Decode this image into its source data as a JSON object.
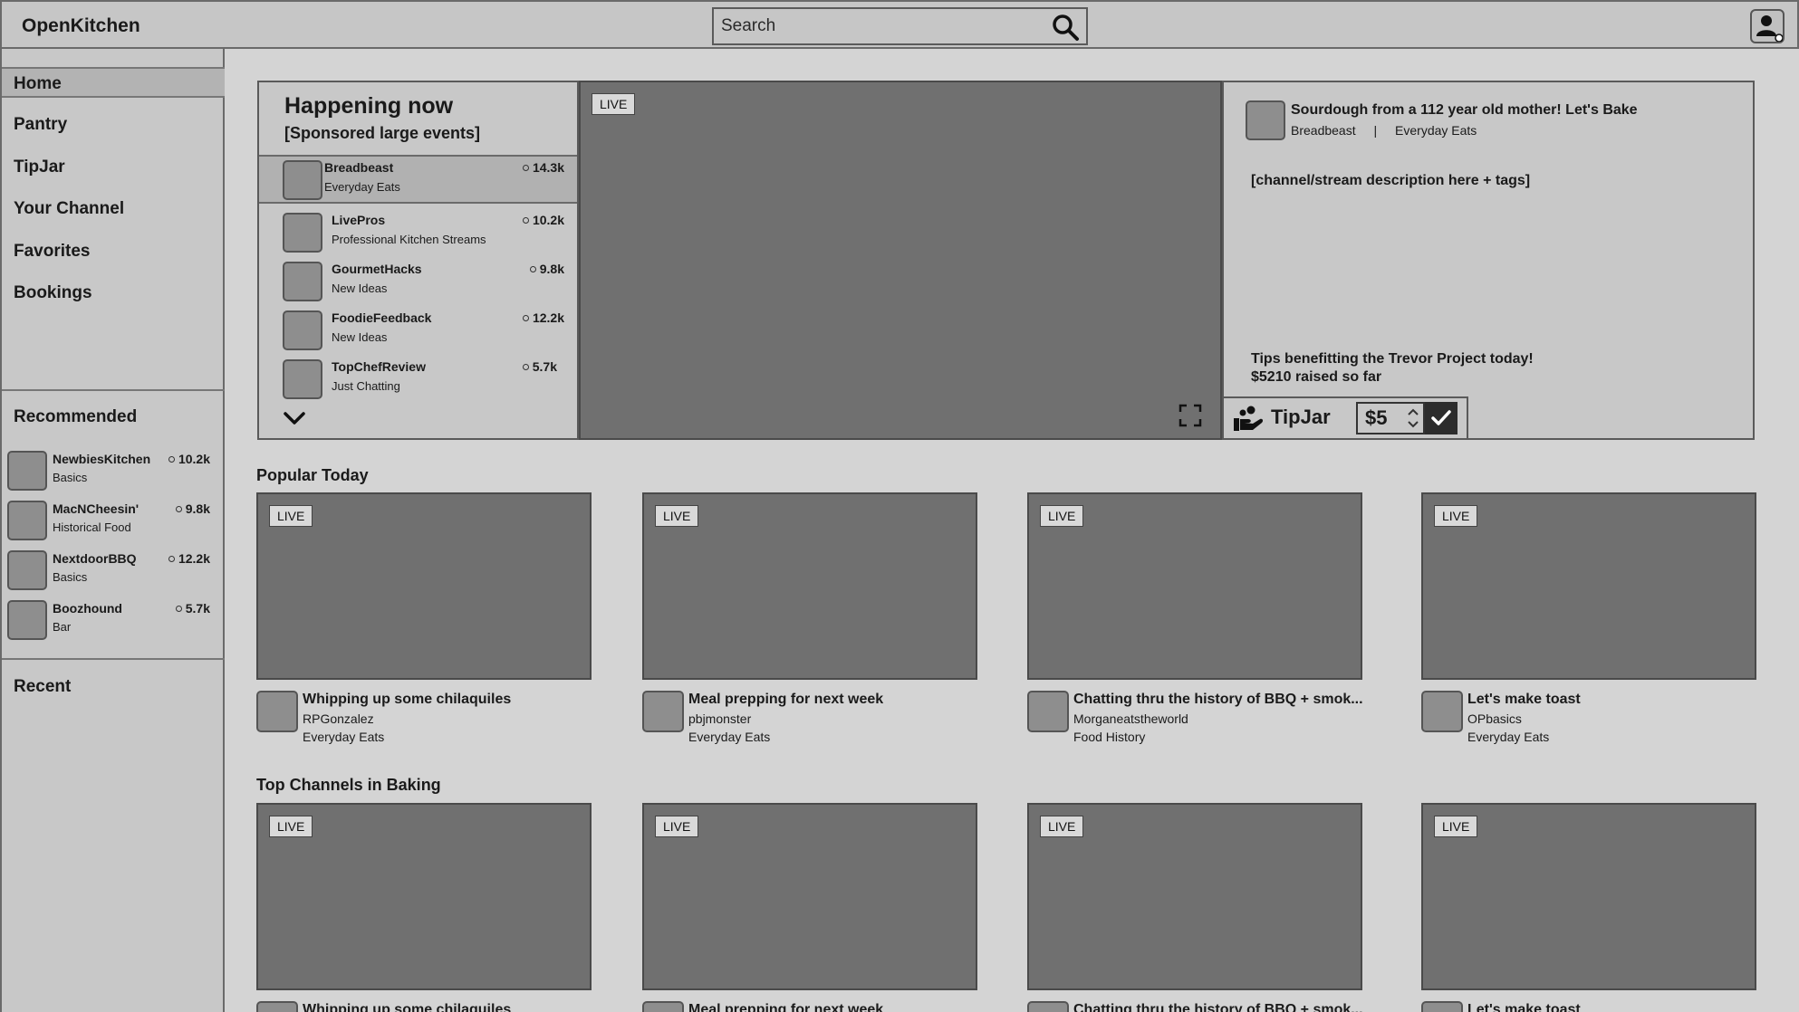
{
  "app": {
    "brand": "OpenKitchen"
  },
  "search": {
    "placeholder": "Search"
  },
  "sidebar": {
    "nav": [
      "Home",
      "Pantry",
      "TipJar",
      "Your Channel",
      "Favorites",
      "Bookings"
    ],
    "recommended_title": "Recommended",
    "recommended": [
      {
        "name": "NewbiesKitchen",
        "category": "Basics",
        "viewers": "10.2k"
      },
      {
        "name": "MacNCheesin'",
        "category": "Historical Food",
        "viewers": "9.8k"
      },
      {
        "name": "NextdoorBBQ",
        "category": "Basics",
        "viewers": "12.2k"
      },
      {
        "name": "Boozhound",
        "category": "Bar",
        "viewers": "5.7k"
      }
    ],
    "recent_title": "Recent"
  },
  "happening": {
    "title": "Happening now",
    "subtitle": "[Sponsored large events]",
    "items": [
      {
        "name": "Breadbeast",
        "category": "Everyday Eats",
        "viewers": "14.3k"
      },
      {
        "name": "LivePros",
        "category": "Professional Kitchen Streams",
        "viewers": "10.2k"
      },
      {
        "name": "GourmetHacks",
        "category": "New Ideas",
        "viewers": "9.8k"
      },
      {
        "name": "FoodieFeedback",
        "category": "New Ideas",
        "viewers": "12.2k"
      },
      {
        "name": "TopChefReview",
        "category": "Just Chatting",
        "viewers": "5.7k"
      }
    ]
  },
  "player": {
    "live": "LIVE"
  },
  "stream_info": {
    "title": "Sourdough from a 112 year old mother!  Let's Bake",
    "channel": "Breadbeast",
    "separator": "|",
    "category": "Everyday Eats",
    "description": "[channel/stream description here + tags]",
    "tips_line1": "Tips benefitting the Trevor Project today!",
    "tips_line2": "$5210 raised so far",
    "tipjar_label": "TipJar",
    "tip_amount": "$5"
  },
  "popular": {
    "title": "Popular Today",
    "cards": [
      {
        "live": "LIVE",
        "title": "Whipping up some chilaquiles",
        "user": "RPGonzalez",
        "category": "Everyday Eats"
      },
      {
        "live": "LIVE",
        "title": "Meal prepping for next week",
        "user": "pbjmonster",
        "category": "Everyday Eats"
      },
      {
        "live": "LIVE",
        "title": "Chatting thru the history of BBQ + smok...",
        "user": "Morganeatstheworld",
        "category": "Food History"
      },
      {
        "live": "LIVE",
        "title": "Let's make toast",
        "user": "OPbasics",
        "category": "Everyday Eats"
      }
    ]
  },
  "baking": {
    "title": "Top Channels in Baking",
    "cards": [
      {
        "live": "LIVE",
        "title": "Whipping up some chilaquiles"
      },
      {
        "live": "LIVE",
        "title": "Meal prepping for next week"
      },
      {
        "live": "LIVE",
        "title": "Chatting thru the history of BBQ + smok..."
      },
      {
        "live": "LIVE",
        "title": "Let's make toast"
      }
    ]
  }
}
